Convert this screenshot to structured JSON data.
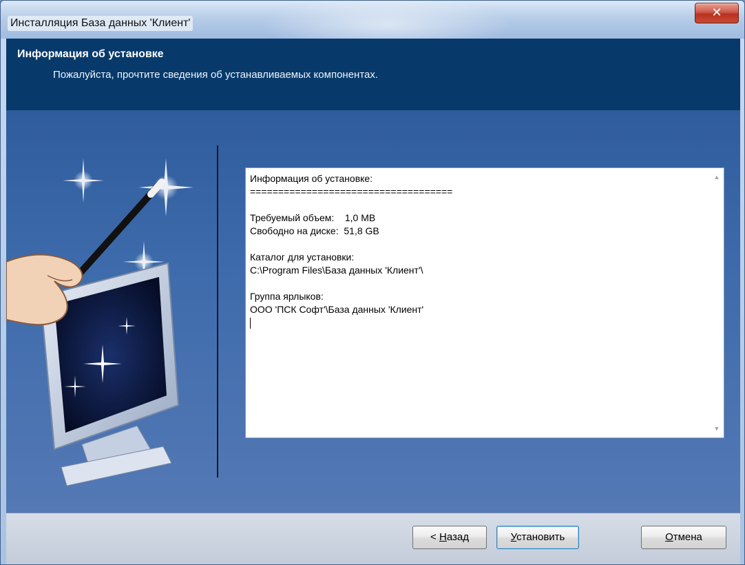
{
  "window": {
    "title": "Инсталляция База данных 'Клиент'",
    "close_glyph": "✕"
  },
  "header": {
    "title": "Информация об установке",
    "subtitle": "Пожалуйста, прочтите сведения об устанавливаемых компонентах."
  },
  "info_box": {
    "lines": [
      "Информация об установке:",
      "====================================",
      "",
      "Требуемый объем:    1,0 MB",
      "Свободно на диске:  51,8 GB",
      "",
      "Каталог для установки:",
      "C:\\Program Files\\База данных 'Клиент'\\",
      "",
      "Группа ярлыков:",
      "ООО 'ПСК Софт'\\База данных 'Клиент'"
    ]
  },
  "buttons": {
    "back_prefix": "< ",
    "back_mnemonic": "Н",
    "back_rest": "азад",
    "install_mnemonic": "У",
    "install_rest": "становить",
    "cancel_mnemonic": "О",
    "cancel_rest": "тмена"
  },
  "colors": {
    "header_bg": "#073a6b",
    "body_bg": "#3e6bab",
    "close_red": "#c94a35"
  },
  "icons": {
    "art": "magic-wand-monitor-icon",
    "close": "close-icon"
  }
}
